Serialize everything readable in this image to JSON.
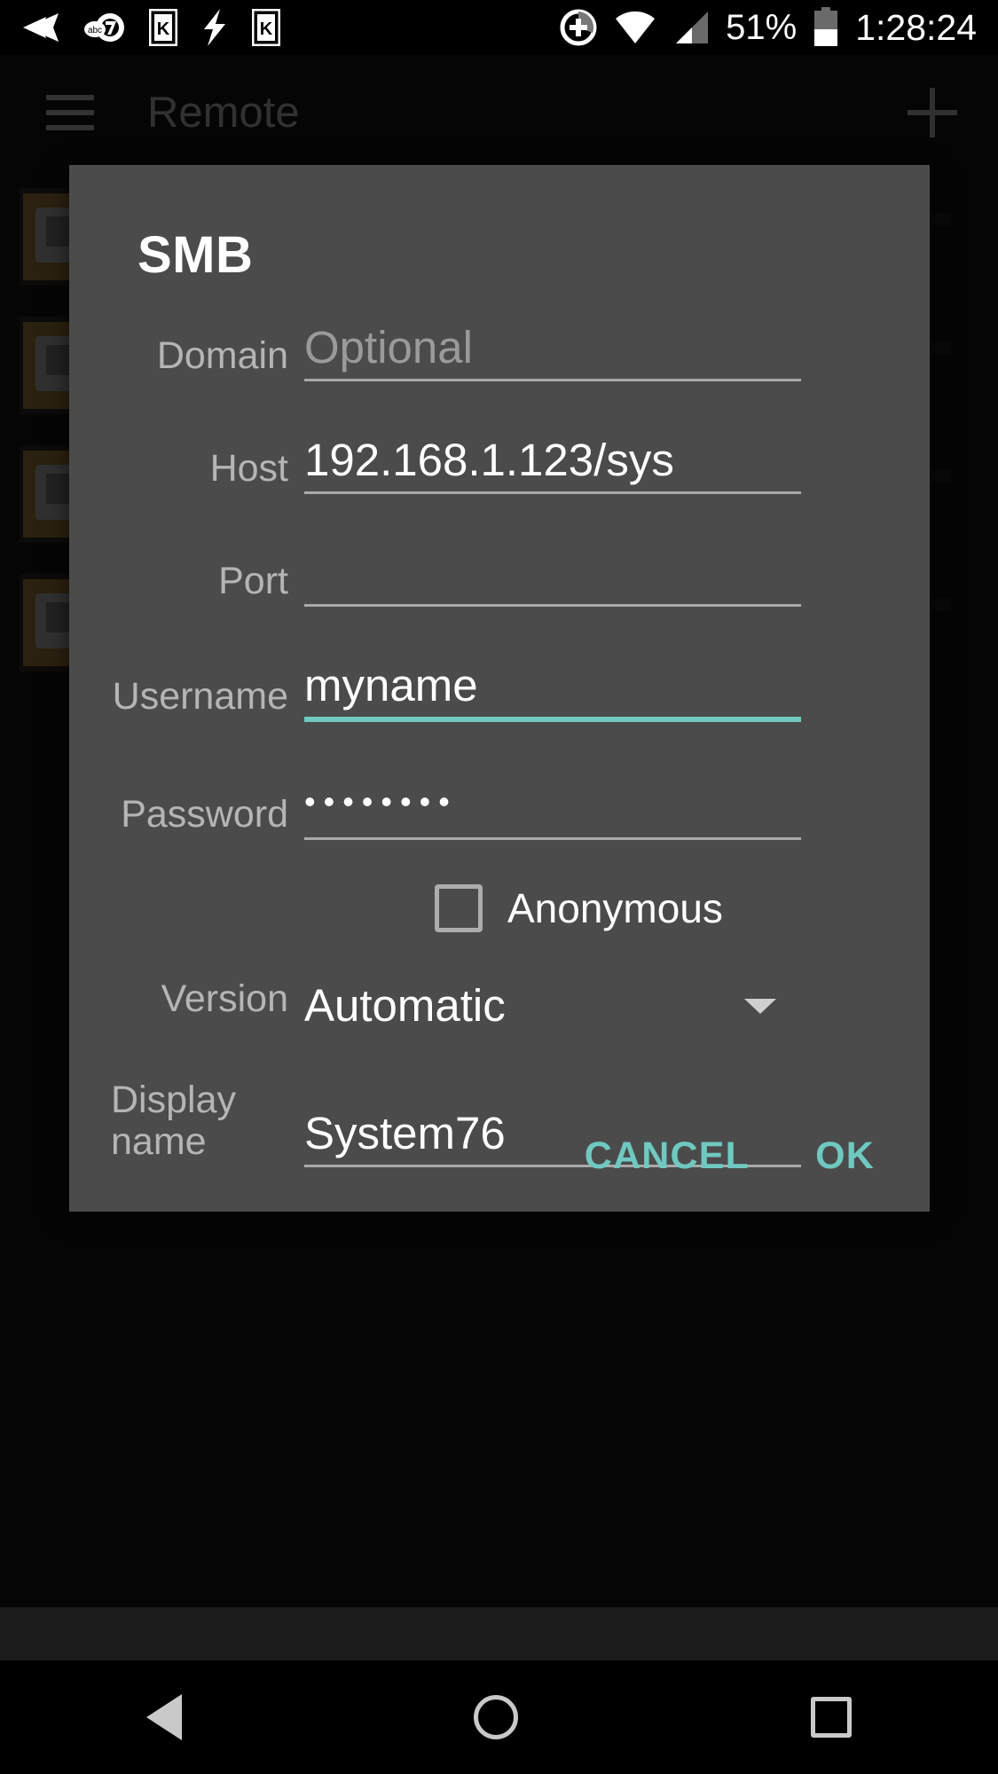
{
  "statusbar": {
    "icons_left": [
      "rewind-icon",
      "abc7-logo-icon",
      "k-app-icon",
      "lightning-bolt-icon",
      "k-app-icon-2"
    ],
    "icons_right": [
      "screen-record-icon",
      "wifi-icon",
      "cell-signal-icon",
      "battery-icon"
    ],
    "battery_percent": "51%",
    "clock": "1:28:24"
  },
  "appbar": {
    "menu_icon": "hamburger-menu-icon",
    "title": "Remote",
    "add_icon": "plus-icon"
  },
  "dialog": {
    "title": "SMB",
    "fields": [
      {
        "label": "Domain",
        "value": "",
        "placeholder": "Optional",
        "focused": false
      },
      {
        "label": "Host",
        "value": "192.168.1.123/sys",
        "placeholder": "",
        "focused": false
      },
      {
        "label": "Port",
        "value": "",
        "placeholder": "",
        "focused": false
      },
      {
        "label": "Username",
        "value": "myname",
        "placeholder": "",
        "focused": true
      },
      {
        "label": "Password",
        "value": "••••••••",
        "placeholder": "",
        "focused": false
      }
    ],
    "anonymous": {
      "label": "Anonymous",
      "checked": false
    },
    "version": {
      "label": "Version",
      "value": "Automatic",
      "caret_icon": "chevron-down-icon"
    },
    "display_name": {
      "label": "Display name",
      "value": "System76"
    },
    "buttons": {
      "cancel": "CANCEL",
      "ok": "OK"
    },
    "accent_color": "#6fc9c0"
  },
  "navbar": {
    "back": "back-triangle-icon",
    "home": "home-circle-icon",
    "recents": "recents-square-icon"
  }
}
